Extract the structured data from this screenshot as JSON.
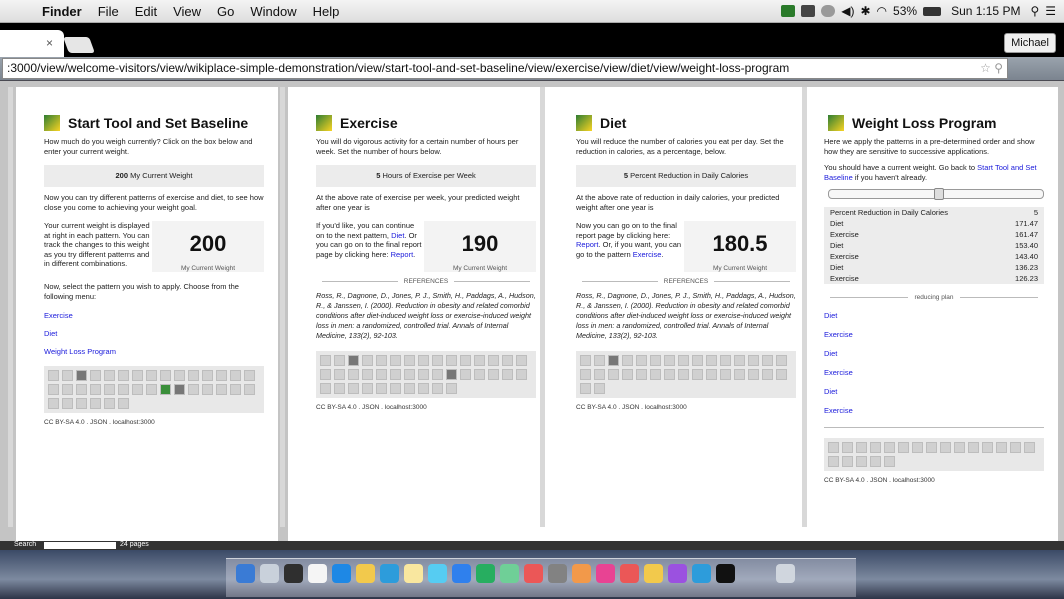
{
  "menubar": {
    "app": "Finder",
    "items": [
      "File",
      "Edit",
      "View",
      "Go",
      "Window",
      "Help"
    ],
    "battery": "53%",
    "clock": "Sun 1:15 PM"
  },
  "browser": {
    "tab_close": "×",
    "user_button": "Michael",
    "url": ":3000/view/welcome-visitors/view/wikiplace-simple-demonstration/view/start-tool-and-set-baseline/view/exercise/view/diet/view/weight-loss-program"
  },
  "panel1": {
    "title": "Start Tool and Set Baseline",
    "intro": "How much do you weigh currently? Click on the box below and enter your current weight.",
    "input_value": "200",
    "input_label": "My Current Weight",
    "para2": "Now you can try different patterns of exercise and diet, to see how close you come to achieving your weight goal.",
    "side_text": "Your current weight is displayed at right in each pattern. You can track the changes to this weight as you try different patterns and in different combinations.",
    "big_number": "200",
    "big_caption": "My Current Weight",
    "para3": "Now, select the pattern you wish to apply. Choose from the following menu:",
    "links": [
      "Exercise",
      "Diet",
      "Weight Loss Program"
    ],
    "footer": "CC BY-SA 4.0 . JSON . localhost:3000"
  },
  "panel2": {
    "title": "Exercise",
    "intro": "You will do vigorous activity for a certain number of hours per week. Set the number of hours below.",
    "input_value": "5",
    "input_label": "Hours of Exercise per Week",
    "para2": "At the above rate of exercise per week, your predicted weight after one year is",
    "side_pre": "If you'd like, you can continue on to the next pattern, ",
    "side_link1": "Diet",
    "side_mid": ". Or you can go on to the final report page by clicking here: ",
    "side_link2": "Report",
    "side_post": ".",
    "big_number": "190",
    "big_caption": "My Current Weight",
    "ref_head": "REFERENCES",
    "reference": "Ross, R., Dagnone, D., Jones, P. J., Smith, H., Paddags, A., Hudson, R., & Janssen, I. (2000). Reduction in obesity and related comorbid conditions after diet-induced weight loss or exercise-induced weight loss in men: a randomized, controlled trial. Annals of Internal Medicine, 133(2), 92-103.",
    "footer": "CC BY-SA 4.0 . JSON . localhost:3000"
  },
  "panel3": {
    "title": "Diet",
    "intro": "You will reduce the number of calories you eat per day. Set the reduction in calories, as a percentage, below.",
    "input_value": "5",
    "input_label": "Percent Reduction in Daily Calories",
    "para2": "At the above rate of reduction in daily calories, your predicted weight after one year is",
    "side_pre": "Now you can go on to the final report page by clicking here: ",
    "side_link1": "Report",
    "side_mid": ". Or, if you want, you can go to the pattern ",
    "side_link2": "Exercise",
    "side_post": ".",
    "big_number": "180.5",
    "big_caption": "My Current Weight",
    "ref_head": "REFERENCES",
    "reference": "Ross, R., Dagnone, D., Jones, P. J., Smith, H., Paddags, A., Hudson, R., & Janssen, I. (2000). Reduction in obesity and related comorbid conditions after diet-induced weight loss or exercise-induced weight loss in men: a randomized, controlled trial. Annals of Internal Medicine, 133(2), 92-103.",
    "footer": "CC BY-SA 4.0 . JSON . localhost:3000"
  },
  "panel4": {
    "title": "Weight Loss Program",
    "intro": "Here we apply the patterns in a pre-determined order and show how they are sensitive to successive applications.",
    "note_pre": "You should have a current weight. Go back to ",
    "note_link": "Start Tool and Set Baseline",
    "note_post": " if you haven't already.",
    "table": [
      [
        "Percent Reduction in Daily Calories",
        "5"
      ],
      [
        "Diet",
        "171.47"
      ],
      [
        "Exercise",
        "161.47"
      ],
      [
        "Diet",
        "153.40"
      ],
      [
        "Exercise",
        "143.40"
      ],
      [
        "Diet",
        "136.23"
      ],
      [
        "Exercise",
        "126.23"
      ]
    ],
    "plan_head": "reducing plan",
    "plan_links": [
      "Diet",
      "Exercise",
      "Diet",
      "Exercise",
      "Diet",
      "Exercise"
    ],
    "footer": "CC BY-SA 4.0 . JSON . localhost:3000"
  },
  "statusbar": {
    "search_label": "Search",
    "pages": "24 pages"
  }
}
